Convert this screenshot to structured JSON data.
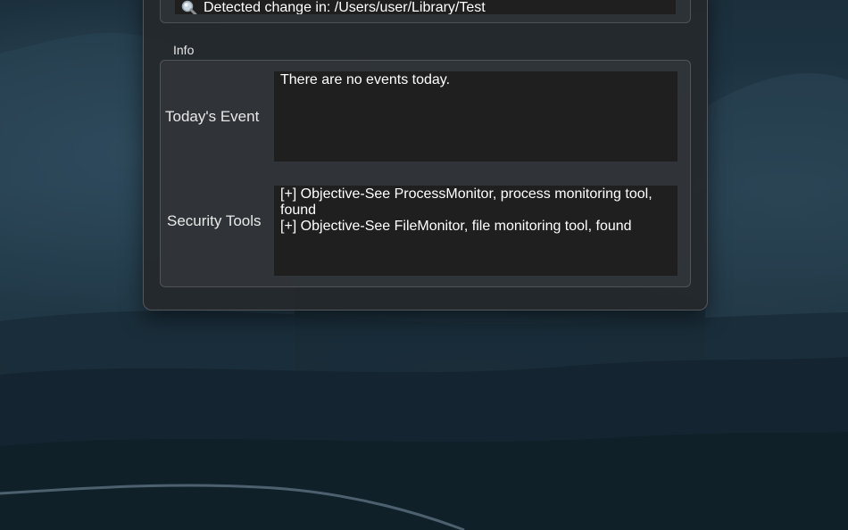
{
  "log": {
    "line_text": "Detected change in: /Users/user/Library/Test",
    "line_icon": "magnifier-icon"
  },
  "info": {
    "section_label": "Info",
    "todays_event": {
      "label": "Today's Event",
      "value": "There are no events today."
    },
    "security_tools": {
      "label": "Security Tools",
      "value": "[+] Objective-See ProcessMonitor, process monitoring tool, found\n[+] Objective-See FileMonitor, file monitoring tool, found"
    }
  },
  "colors": {
    "panel_background": "#24282c",
    "text_area_background": "#1f1f1f",
    "text": "#ffffff"
  }
}
